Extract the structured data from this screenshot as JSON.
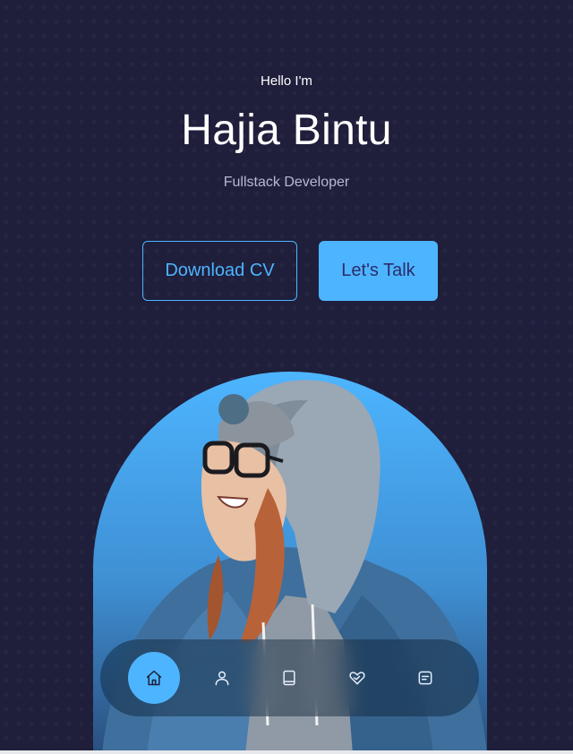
{
  "header": {
    "greeting": "Hello I'm",
    "name": "Hajia Bintu",
    "role": "Fullstack Developer"
  },
  "cta": {
    "download_label": "Download CV",
    "talk_label": "Let's Talk"
  },
  "nav": {
    "items": [
      {
        "icon": "home-icon",
        "active": true
      },
      {
        "icon": "user-icon",
        "active": false
      },
      {
        "icon": "book-icon",
        "active": false
      },
      {
        "icon": "services-icon",
        "active": false
      },
      {
        "icon": "message-icon",
        "active": false
      }
    ]
  },
  "colors": {
    "background": "#1f1e3b",
    "accent": "#4db5ff",
    "muted_text": "#b9b8cf"
  }
}
